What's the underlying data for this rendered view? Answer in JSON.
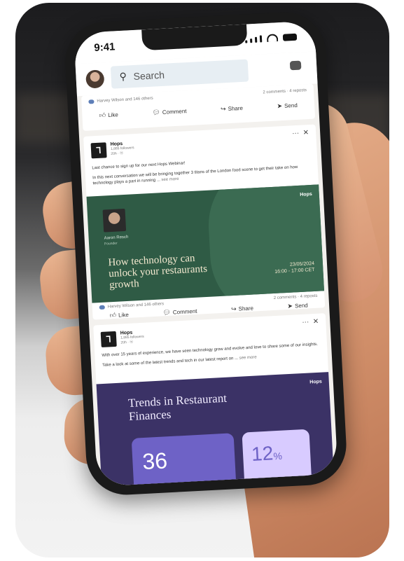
{
  "status": {
    "time": "9:41"
  },
  "search": {
    "placeholder": "Search"
  },
  "prev_post": {
    "reactions": "Harvey Wilson and 146 others",
    "counts": "2 comments · 4 reposts"
  },
  "actions": {
    "like": "Like",
    "comment": "Comment",
    "share": "Share",
    "send": "Send"
  },
  "post1": {
    "author": "Hops",
    "followers": "1,885 followers",
    "time": "20h · ⓦ",
    "line1": "Last chance to sign up for our next Hops Webinar!",
    "line2": "In this next conversation we will be bringing together 3 titans of the London food scene to get their take on how technology plays a part in running ...",
    "see_more": "see more",
    "banner": {
      "brand": "Hops",
      "speaker_name": "Aaron Resch",
      "speaker_role": "Founder",
      "headline": "How technology can unlock your restaurants growth",
      "date": "23/05/2024",
      "time_range": "16:00 - 17:00 CET"
    },
    "reactions": "Harvey Wilson and 146 others",
    "counts": "2 comments · 4 reposts"
  },
  "post2": {
    "author": "Hops",
    "followers": "1,885 followers",
    "time": "20h · ⓦ",
    "line1": "With over 15 years of experience, we have seen technology grow and evolve and love to share some of our insights.",
    "line2": "Take a look at some of the latest trends and tech in our latest report on ...",
    "see_more": "see more",
    "banner": {
      "brand": "Hops",
      "title": "Trends in Restaurant Finances",
      "stat1": "36",
      "stat2": "12",
      "stat2_unit": "%"
    }
  }
}
